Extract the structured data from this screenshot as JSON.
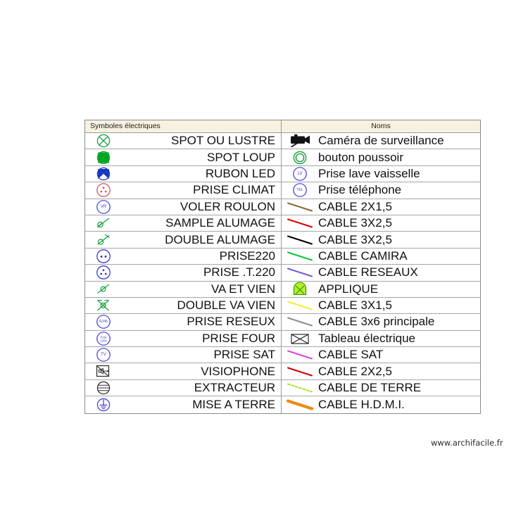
{
  "table": {
    "headers": {
      "left": "Symboles électriques",
      "right": "Noms"
    },
    "left_column": [
      {
        "label": "SPOT OU LUSTRE",
        "icon": "circle-x-green-outline"
      },
      {
        "label": "SPOT LOUP",
        "icon": "circle-x-green-filled"
      },
      {
        "label": "RUBON LED",
        "icon": "circle-x-blue-filled"
      },
      {
        "label": "PRISE CLIMAT",
        "icon": "socket-three-pin-red"
      },
      {
        "label": "VOLER ROULON",
        "icon": "circle-label-vr-blue",
        "icon_text": "VR"
      },
      {
        "label": "SAMPLE ALUMAGE",
        "icon": "switch-single-green"
      },
      {
        "label": "DOUBLE ALUMAGE",
        "icon": "switch-double-green"
      },
      {
        "label": "PRISE220",
        "icon": "socket-two-pin-blue"
      },
      {
        "label": "PRISE .T.220",
        "icon": "socket-three-pin-blue"
      },
      {
        "label": "VA ET VIEN",
        "icon": "switch-two-way-green"
      },
      {
        "label": "DOUBLE VA VIEN",
        "icon": "switch-double-two-way-green"
      },
      {
        "label": "PRISE RESEUX",
        "icon": "circle-label-rj45-blue",
        "icon_text": "RJ45"
      },
      {
        "label": "PRISE FOUR",
        "icon": "circle-label-four-blue",
        "icon_text": "Four 220v"
      },
      {
        "label": "PRISE SAT",
        "icon": "circle-label-tv-blue",
        "icon_text": "TV"
      },
      {
        "label": "VISIOPHONE",
        "icon": "visiophone-speaker-box"
      },
      {
        "label": "EXTRACTEUR",
        "icon": "extractor-fan-circle"
      },
      {
        "label": "MISE A TERRE",
        "icon": "earth-ground-circle"
      }
    ],
    "right_column": [
      {
        "label": "Caméra de surveillance",
        "icon": "camera-black"
      },
      {
        "label": "bouton poussoir",
        "icon": "double-circle-green"
      },
      {
        "label": "Prise lave vaisselle",
        "icon": "circle-label-lv-blue",
        "icon_text": "LV"
      },
      {
        "label": "Prise téléphone",
        "icon": "circle-label-tel-blue",
        "icon_text": "TÉL"
      },
      {
        "label": "CABLE 2X1,5",
        "icon": "cable-line",
        "color": "#8a6a30"
      },
      {
        "label": "CABLE 3X2,5",
        "icon": "cable-line",
        "color": "#e00000"
      },
      {
        "label": "CABLE 3X2,5",
        "icon": "cable-line",
        "color": "#000000"
      },
      {
        "label": "CABLE CAMIRA",
        "icon": "cable-line",
        "color": "#10c43a"
      },
      {
        "label": "CABLE RESEAUX",
        "icon": "cable-line",
        "color": "#6a5de0"
      },
      {
        "label": "APPLIQUE",
        "icon": "applique-dome-green"
      },
      {
        "label": "CABLE 3X1,5",
        "icon": "cable-line",
        "color": "#f2ee3a"
      },
      {
        "label": "CABLE 3x6 principale",
        "icon": "cable-line",
        "color": "#8d8d8d"
      },
      {
        "label": "Tableau électrique",
        "icon": "panel-box-x"
      },
      {
        "label": "CABLE SAT",
        "icon": "cable-line",
        "color": "#dd42dd"
      },
      {
        "label": "CABLE 2X2,5",
        "icon": "cable-line",
        "color": "#cc0000"
      },
      {
        "label": "CABLE DE TERRE",
        "icon": "cable-line-dashed",
        "color": "#a8e32a"
      },
      {
        "label": "CABLE H.D.M.I.",
        "icon": "cable-line-thick",
        "color": "#f08a10"
      }
    ]
  },
  "watermark": "www.archifacile.fr",
  "colors": {
    "header_background": "#f7f2e0",
    "border": "#9b9b9b",
    "row_border": "#a6a6a6",
    "text": "#111111",
    "symbol_blue": "#3a3ad0",
    "symbol_green": "#14a03c",
    "symbol_red": "#d06060"
  }
}
